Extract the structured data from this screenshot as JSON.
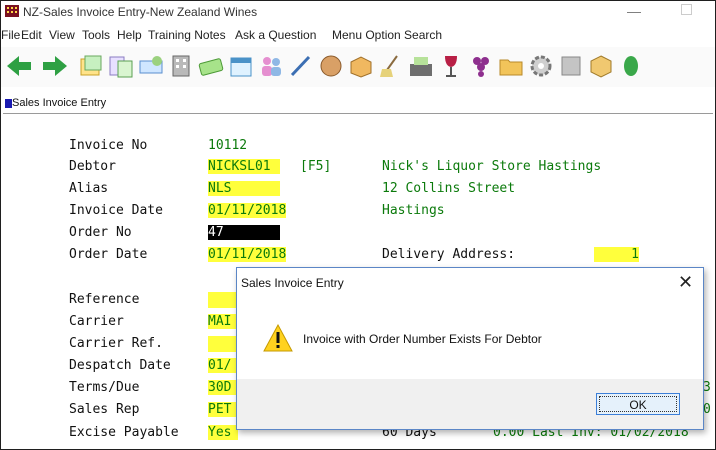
{
  "window": {
    "title": "NZ-Sales Invoice Entry-New Zealand Wines"
  },
  "menu": [
    "File",
    "Edit",
    "View",
    "Tools",
    "Help",
    "Training Notes",
    "Ask a Question",
    "Menu Option Search"
  ],
  "toolbar_icons": [
    "back-arrow-icon",
    "forward-arrow-icon",
    "notes-icon",
    "copy-icon",
    "sign-icon",
    "building-icon",
    "money-icon",
    "calendar-icon",
    "people-icon",
    "pen-icon",
    "barrel-icon",
    "box-icon",
    "broom-icon",
    "cash-register-icon",
    "wine-glass-icon",
    "grapes-icon",
    "folder-icon",
    "settings-gear-icon",
    "panel-icon",
    "cube-icon",
    "leaf-icon"
  ],
  "panel": {
    "title": "Sales Invoice Entry"
  },
  "form": {
    "invoice_no_label": "Invoice No",
    "invoice_no": "10112",
    "debtor_label": "Debtor",
    "debtor": "NICKSL01",
    "debtor_hint": "[F5]",
    "debtor_name": "Nick's Liquor Store Hastings",
    "alias_label": "Alias",
    "alias": "NLS",
    "address1": "12 Collins Street",
    "invoice_date_label": "Invoice Date",
    "invoice_date": "01/11/2018",
    "address2": "Hastings",
    "order_no_label": "Order No",
    "order_no": "47",
    "order_date_label": "Order Date",
    "order_date": "01/11/2018",
    "delivery_label": "Delivery Address:",
    "delivery_value": "1",
    "reference_label": "Reference",
    "carrier_label": "Carrier",
    "carrier": "MAI",
    "carrier_ref_label": "Carrier Ref.",
    "despatch_label": "Despatch Date",
    "despatch": "01/",
    "terms_label": "Terms/Due",
    "terms": "30D",
    "terms_right": "3",
    "sales_rep_label": "Sales Rep",
    "sales_rep": "PET",
    "sales_rep_right": "0",
    "excise_label": "Excise Payable",
    "excise": "Yes",
    "excise_days": "60 Days",
    "excise_right": "0.00 Last Inv: 01/02/2018"
  },
  "dialog": {
    "title": "Sales Invoice Entry",
    "close": "✕",
    "message": "Invoice with Order Number Exists For Debtor",
    "ok": "OK"
  }
}
